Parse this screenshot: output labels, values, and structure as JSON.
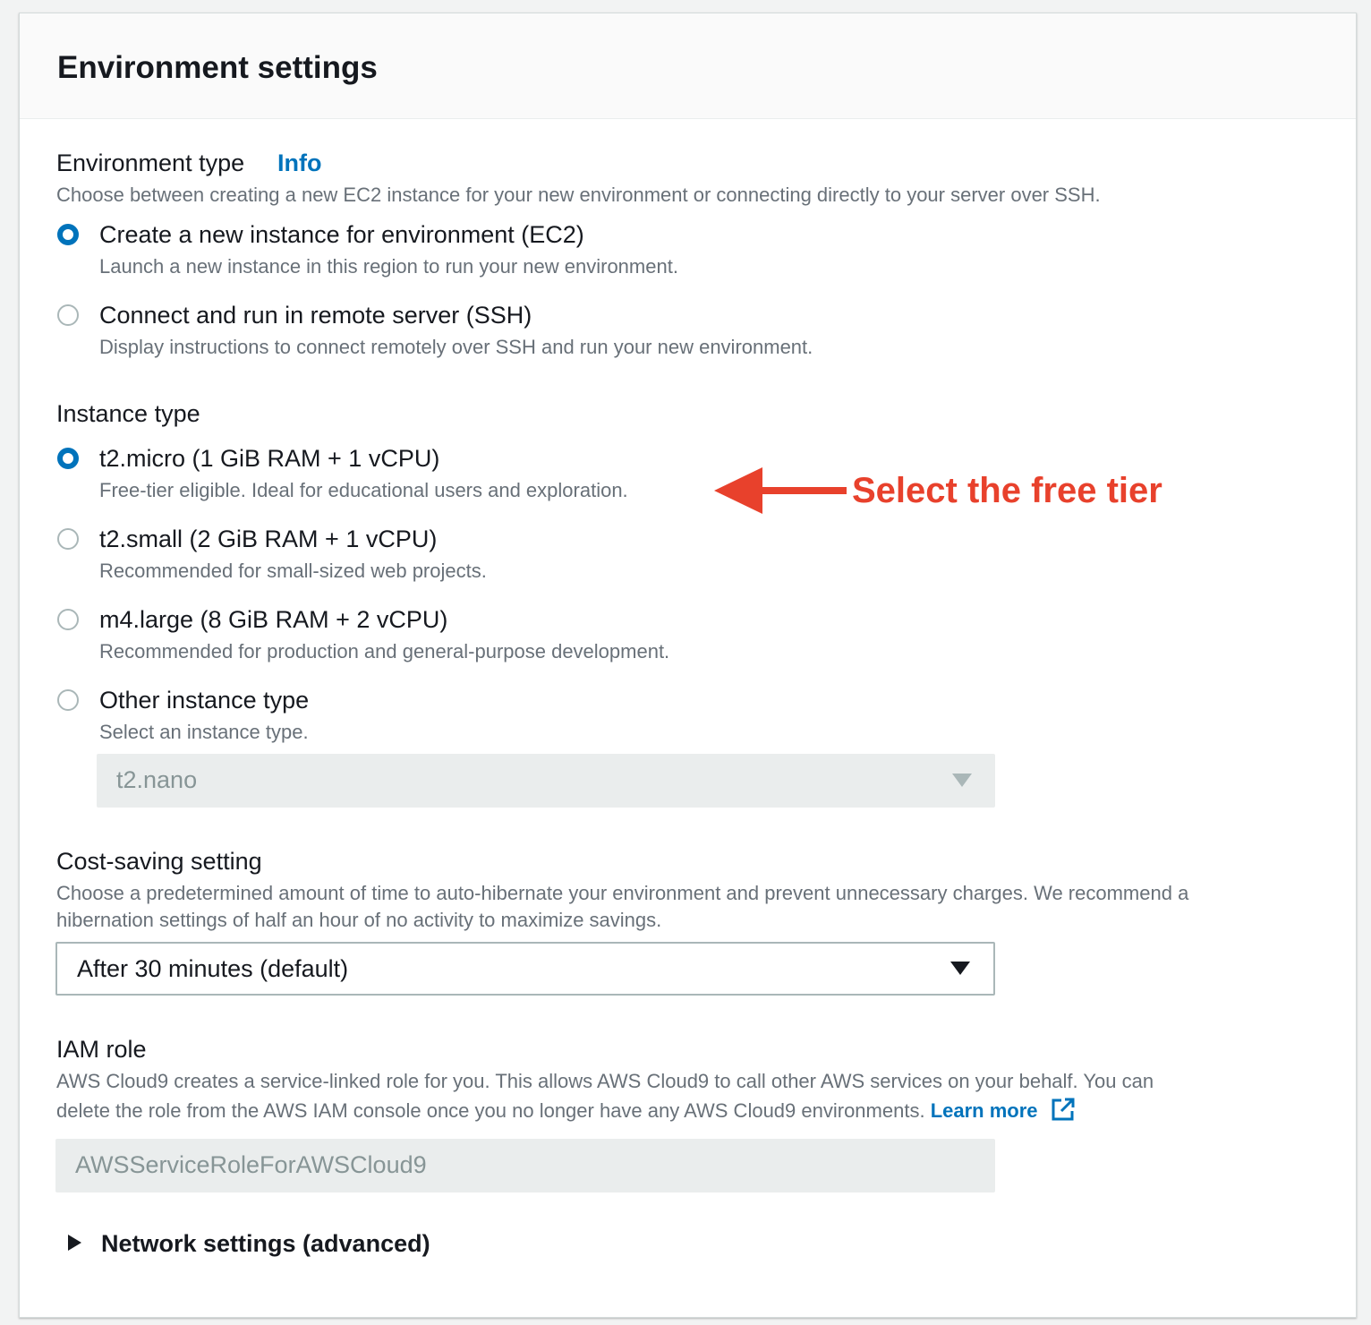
{
  "panel": {
    "title": "Environment settings"
  },
  "environment_type": {
    "label": "Environment type",
    "info_link": "Info",
    "description": "Choose between creating a new EC2 instance for your new environment or connecting directly to your server over SSH.",
    "options": [
      {
        "label": "Create a new instance for environment (EC2)",
        "description": "Launch a new instance in this region to run your new environment.",
        "selected": true
      },
      {
        "label": "Connect and run in remote server (SSH)",
        "description": "Display instructions to connect remotely over SSH and run your new environment.",
        "selected": false
      }
    ]
  },
  "instance_type": {
    "label": "Instance type",
    "options": [
      {
        "label": "t2.micro (1 GiB RAM + 1 vCPU)",
        "description": "Free-tier eligible. Ideal for educational users and exploration.",
        "selected": true
      },
      {
        "label": "t2.small (2 GiB RAM + 1 vCPU)",
        "description": "Recommended for small-sized web projects.",
        "selected": false
      },
      {
        "label": "m4.large (8 GiB RAM + 2 vCPU)",
        "description": "Recommended for production and general-purpose development.",
        "selected": false
      },
      {
        "label": "Other instance type",
        "description": "Select an instance type.",
        "selected": false
      }
    ],
    "other_select_value": "t2.nano"
  },
  "cost_saving": {
    "label": "Cost-saving setting",
    "description_line1": "Choose a predetermined amount of time to auto-hibernate your environment and prevent unnecessary charges. We recommend a",
    "description_line2": "hibernation settings of half an hour of no activity to maximize savings.",
    "selected_value": "After 30 minutes (default)"
  },
  "iam_role": {
    "label": "IAM role",
    "description_line1": "AWS Cloud9 creates a service-linked role for you. This allows AWS Cloud9 to call other AWS services on your behalf. You can",
    "description_line2": "delete the role from the AWS IAM console once you no longer have any AWS Cloud9 environments.",
    "learn_more": "Learn more",
    "value": "AWSServiceRoleForAWSCloud9"
  },
  "network_settings": {
    "label": "Network settings (advanced)"
  },
  "annotation": {
    "text": "Select the free tier",
    "color": "#e8412c"
  },
  "colors": {
    "link": "#0073bb",
    "radio_selected": "#0073bb"
  }
}
